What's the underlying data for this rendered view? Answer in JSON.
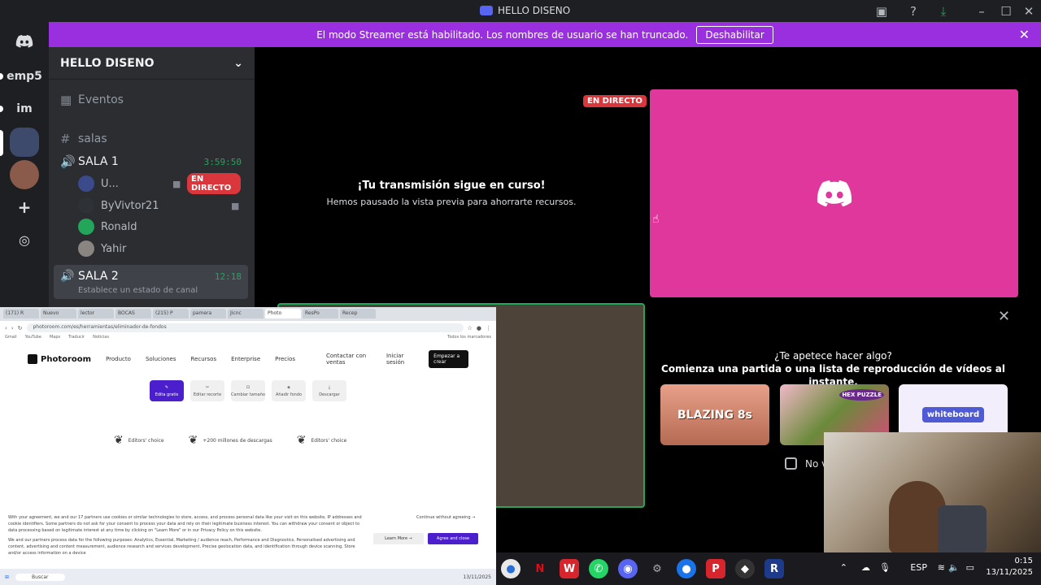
{
  "window": {
    "title": "HELLO DISENO"
  },
  "banner": {
    "text": "El modo Streamer está habilitado. Los nombres de usuario se han truncado.",
    "button": "Deshabilitar"
  },
  "rail": {
    "items": [
      "emp5",
      "im"
    ]
  },
  "server": {
    "name": "HELLO DISENO"
  },
  "channels": {
    "events": "Eventos",
    "category": "salas",
    "sala1": {
      "name": "SALA 1",
      "timer": "3:59:50"
    },
    "users": [
      {
        "name": "U...",
        "live": "EN DIRECTO"
      },
      {
        "name": "ByVivtor21"
      },
      {
        "name": "Ronald"
      },
      {
        "name": "Yahir"
      }
    ],
    "sala2": {
      "name": "SALA 2",
      "timer": "12:18",
      "status": "Establece un estado de canal"
    }
  },
  "stage": {
    "live_tag": "EN DIRECTO",
    "paused_title": "¡Tu transmisión sigue en curso!",
    "paused_sub": "Hemos pausado la vista previa para ahorrarte recursos.",
    "activity_title": "¿Te apetece hacer algo?",
    "activity_sub": "Comienza una partida o una lista de reproducción de vídeos al instante.",
    "games": [
      "BLAZING 8s",
      "HEX PUZZLE",
      "whiteboard"
    ],
    "checkbox_label": "No v"
  },
  "browser": {
    "tabs": [
      "(171) R",
      "Nuevo",
      "lector",
      "BOCAS",
      "(215) P",
      "pamera",
      "Jicnc",
      "Photo",
      "ResPo",
      "Recep"
    ],
    "url": "photoroom.com/es/herramientas/eliminador-de-fondos",
    "bookmarks": [
      "Gmail",
      "YouTube",
      "Maps",
      "Traducir",
      "Noticias"
    ],
    "bookmarks_right": "Todos los marcadores",
    "nav": {
      "logo": "Photoroom",
      "items": [
        "Producto",
        "Soluciones",
        "Recursos",
        "Enterprise",
        "Precios"
      ],
      "contact": "Contactar con ventas",
      "login": "Iniciar sesión",
      "cta": "Empezar a crear"
    },
    "tools": [
      "Edita gratis",
      "Editar recorte",
      "Cambiar tamaño",
      "Añadir fondo",
      "Descargar"
    ],
    "badges": [
      "Editors' choice",
      "+200 millones de descargas",
      "Editors' choice"
    ],
    "consent": "With your agreement, we and our 17 partners use cookies or similar technologies to store, access, and process personal data like your visit on this website, IP addresses and cookie identifiers. Some partners do not ask for your consent to process your data and rely on their legitimate business interest. You can withdraw your consent or object to data processing based on legitimate interest at any time by clicking on \"Learn More\" or in our Privacy Policy on this website.",
    "consent2": "We and our partners process data for the following purposes: Analytics, Essential, Marketing / audience reach, Performance and Diagnostics, Personalised advertising and content, advertising and content measurement, audience research and services development, Precise geolocation data, and identification through device scanning, Store and/or access information on a device",
    "continue": "Continue without agreeing →",
    "learn": "Learn More →",
    "agree": "Agree and close",
    "search": "Buscar",
    "date": "13/11/2025"
  },
  "taskbar": {
    "lang": "ESP",
    "time": "0:15",
    "date": "13/11/2025"
  }
}
